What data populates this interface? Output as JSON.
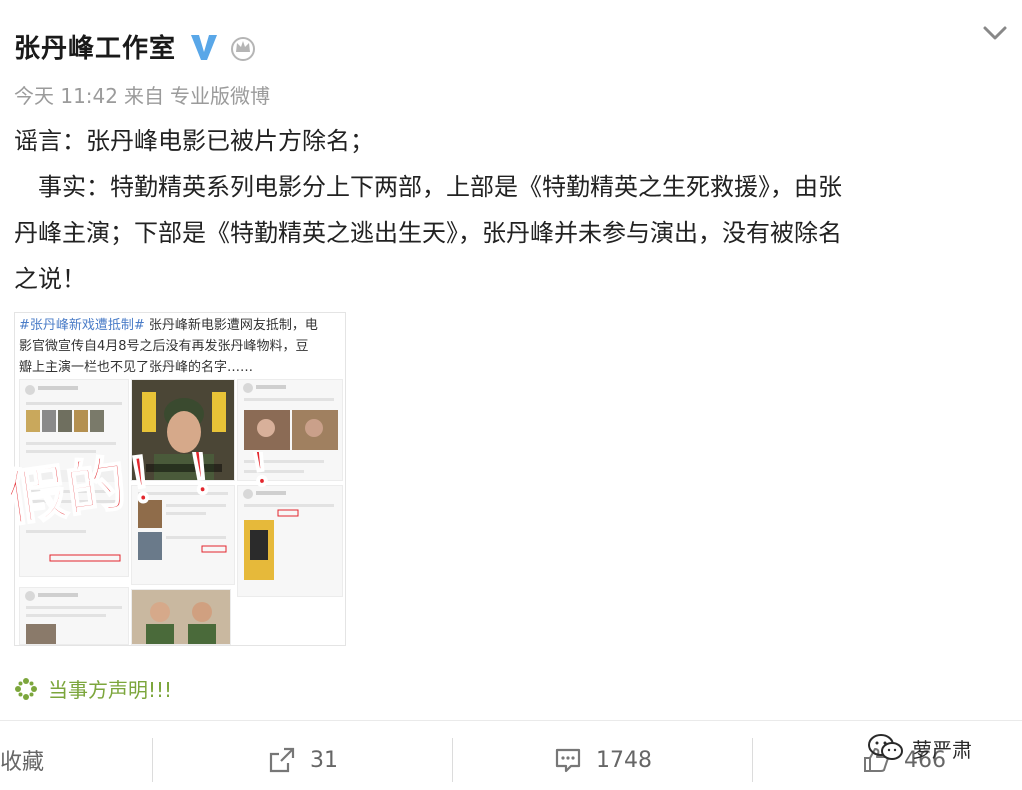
{
  "post": {
    "author": "张丹峰工作室",
    "time": "今天 11:42",
    "from_label": "来自",
    "source": "专业版微博",
    "lines": [
      "谣言：张丹峰电影已被片方除名；",
      "　事实：特勤精英系列电影分上下两部，上部是《特勤精英之生死救援》，由张",
      "丹峰主演；下部是《特勤精英之逃出生天》，张丹峰并未参与演出，没有被除名",
      "之说！"
    ]
  },
  "card": {
    "tag": "#张丹峰新戏遭抵制#",
    "text_line1": " 张丹峰新电影遭网友抵制，电",
    "text_line2": "影官微宣传自4月8号之后没有再发张丹峰物料，豆",
    "text_line3": "瓣上主演一栏也不见了张丹峰的名字……",
    "stamp": "假的！！！"
  },
  "statement": {
    "label": "当事方声明!!!"
  },
  "actions": {
    "favorite_label": "收藏",
    "repost_count": "31",
    "comment_count": "1748",
    "like_count": "466"
  },
  "watermark": {
    "label": "萝严肃"
  },
  "icons": {
    "verified": "verified-v-icon",
    "crown": "member-crown-icon",
    "collapse": "chevron-down-icon",
    "statement": "link-asterisk-icon",
    "repost": "repost-icon",
    "comment": "comment-icon",
    "like": "thumb-up-icon"
  },
  "colors": {
    "verified": "#59a7e8",
    "link_green": "#7ca63c",
    "tag_blue": "#4a7cc7",
    "stamp_red": "#e3262d"
  }
}
